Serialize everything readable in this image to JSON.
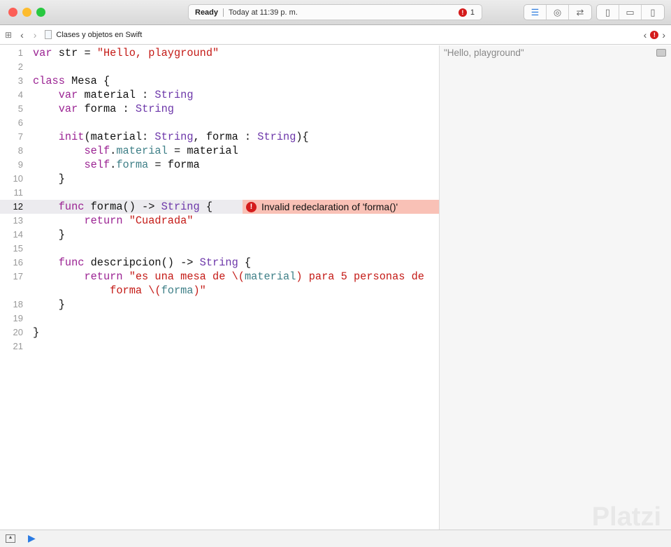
{
  "window": {
    "status": "Ready",
    "timestamp": "Today at 11:39 p. m.",
    "error_count": "1"
  },
  "jump_bar": {
    "file": "Clases y objetos en Swift",
    "error_badge": "!"
  },
  "code_lines": [
    {
      "n": "1",
      "tokens": [
        [
          "k",
          "var"
        ],
        [
          "n",
          " str = "
        ],
        [
          "s",
          "\"Hello, playground\""
        ]
      ]
    },
    {
      "n": "2",
      "tokens": []
    },
    {
      "n": "3",
      "tokens": [
        [
          "k",
          "class"
        ],
        [
          "n",
          " Mesa {"
        ]
      ]
    },
    {
      "n": "4",
      "tokens": [
        [
          "n",
          "    "
        ],
        [
          "k",
          "var"
        ],
        [
          "n",
          " material : "
        ],
        [
          "t",
          "String"
        ]
      ]
    },
    {
      "n": "5",
      "tokens": [
        [
          "n",
          "    "
        ],
        [
          "k",
          "var"
        ],
        [
          "n",
          " forma : "
        ],
        [
          "t",
          "String"
        ]
      ]
    },
    {
      "n": "6",
      "tokens": []
    },
    {
      "n": "7",
      "tokens": [
        [
          "n",
          "    "
        ],
        [
          "k",
          "init"
        ],
        [
          "n",
          "(material: "
        ],
        [
          "t",
          "String"
        ],
        [
          "n",
          ", forma : "
        ],
        [
          "t",
          "String"
        ],
        [
          "n",
          "){"
        ]
      ]
    },
    {
      "n": "8",
      "tokens": [
        [
          "n",
          "        "
        ],
        [
          "k",
          "self"
        ],
        [
          "n",
          "."
        ],
        [
          "p",
          "material"
        ],
        [
          "n",
          " = material"
        ]
      ]
    },
    {
      "n": "9",
      "tokens": [
        [
          "n",
          "        "
        ],
        [
          "k",
          "self"
        ],
        [
          "n",
          "."
        ],
        [
          "p",
          "forma"
        ],
        [
          "n",
          " = forma"
        ]
      ]
    },
    {
      "n": "10",
      "tokens": [
        [
          "n",
          "    }"
        ]
      ]
    },
    {
      "n": "11",
      "tokens": []
    },
    {
      "n": "12",
      "tokens": [
        [
          "n",
          "    "
        ],
        [
          "k",
          "func"
        ],
        [
          "n",
          " forma() -> "
        ],
        [
          "t",
          "String"
        ],
        [
          "n",
          " {"
        ]
      ]
    },
    {
      "n": "13",
      "tokens": [
        [
          "n",
          "        "
        ],
        [
          "k",
          "return"
        ],
        [
          "n",
          " "
        ],
        [
          "s",
          "\"Cuadrada\""
        ]
      ]
    },
    {
      "n": "14",
      "tokens": [
        [
          "n",
          "    }"
        ]
      ]
    },
    {
      "n": "15",
      "tokens": []
    },
    {
      "n": "16",
      "tokens": [
        [
          "n",
          "    "
        ],
        [
          "k",
          "func"
        ],
        [
          "n",
          " descripcion() -> "
        ],
        [
          "t",
          "String"
        ],
        [
          "n",
          " {"
        ]
      ]
    },
    {
      "n": "17",
      "tokens": [
        [
          "n",
          "        "
        ],
        [
          "k",
          "return"
        ],
        [
          "n",
          " "
        ],
        [
          "s",
          "\"es una mesa de \\("
        ],
        [
          "p",
          "material"
        ],
        [
          "s",
          ") para 5 personas de"
        ]
      ]
    },
    {
      "n": "",
      "tokens": [
        [
          "s",
          "            forma \\("
        ],
        [
          "p",
          "forma"
        ],
        [
          "s",
          ")\""
        ]
      ]
    },
    {
      "n": "18",
      "tokens": [
        [
          "n",
          "    }"
        ]
      ]
    },
    {
      "n": "19",
      "tokens": []
    },
    {
      "n": "20",
      "tokens": [
        [
          "n",
          "}"
        ]
      ]
    },
    {
      "n": "21",
      "tokens": []
    }
  ],
  "current_line": "12",
  "error": {
    "line": "12",
    "message": "Invalid redeclaration of 'forma()'"
  },
  "results": {
    "line1": "\"Hello, playground\""
  },
  "watermark": "Platzi"
}
